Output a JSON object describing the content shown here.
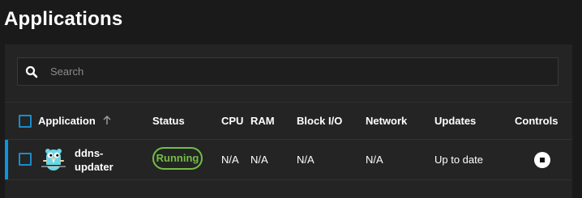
{
  "page": {
    "title": "Applications"
  },
  "search": {
    "placeholder": "Search",
    "value": ""
  },
  "table": {
    "columns": {
      "application": "Application",
      "status": "Status",
      "cpu": "CPU",
      "ram": "RAM",
      "block_io": "Block I/O",
      "network": "Network",
      "updates": "Updates",
      "controls": "Controls"
    },
    "sort": {
      "column": "application",
      "direction": "ascending",
      "icon": "arrow-up-icon"
    },
    "rows": [
      {
        "name": "ddns-updater",
        "icon": "gopher-logo-icon",
        "status": "Running",
        "cpu": "N/A",
        "ram": "N/A",
        "block_io": "N/A",
        "network": "N/A",
        "updates": "Up to date",
        "control_icon": "stop-icon"
      }
    ]
  },
  "colors": {
    "background": "#1a1a1a",
    "card": "#242424",
    "accent": "#0a95e0",
    "running": "#71bf44"
  }
}
